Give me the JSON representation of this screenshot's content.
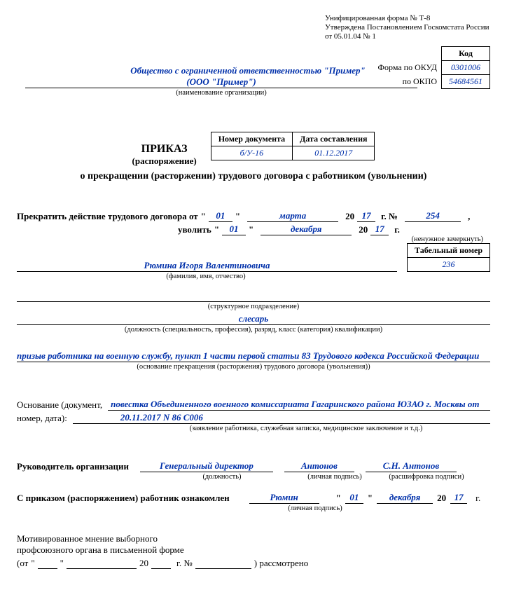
{
  "header": {
    "form_line": "Унифицированная форма № Т-8",
    "approved_line": "Утверждена Постановлением Госкомстата России",
    "date_line": "от 05.01.04 № 1",
    "code_header": "Код",
    "okud_label": "Форма по ОКУД",
    "okud_value": "0301006",
    "okpo_label": "по ОКПО",
    "okpo_value": "54684561"
  },
  "org": {
    "name_line1": "Общество с ограниченной ответственностью \"Пример\"",
    "name_line2": "(ООО \"Пример\")",
    "hint": "(наименование организации)"
  },
  "doc": {
    "num_header": "Номер документа",
    "date_header": "Дата составления",
    "num_value": "б/У-16",
    "date_value": "01.12.2017"
  },
  "title": {
    "main": "ПРИКАЗ",
    "sub": "(распоряжение)",
    "line": "о прекращении (расторжении) трудового договора с работником (увольнении)"
  },
  "terminate": {
    "prefix": "Прекратить действие трудового договора от",
    "day1": "01",
    "month1": "марта",
    "yy1": "17",
    "num_label": "г.  №",
    "num": "254",
    "dismiss_prefix": "уволить",
    "day2": "01",
    "month2": "декабря",
    "yy2": "17",
    "year_suffix": "г.",
    "hint": "(ненужное зачеркнуть)",
    "q_open": "\"",
    "q_close": "\"",
    "twenty": "20",
    "comma": ","
  },
  "employee": {
    "fio": "Рюмина Игоря Валентиновича",
    "fio_hint": "(фамилия, имя, отчество)",
    "tn_header": "Табельный номер",
    "tn_value": "236",
    "dept_hint": "(структурное подразделение)",
    "position": "слесарь",
    "position_hint": "(должность (специальность, профессия), разряд, класс (категория) квалификации)"
  },
  "reason": {
    "text": "призыв работника на военную службу, пункт 1 части первой статьи 83 Трудового кодекса Российской Федерации",
    "hint": "(основание прекращения (расторжения) трудового договора (увольнения))"
  },
  "basis": {
    "label1": "Основание (документ,",
    "label2": "номер, дата):",
    "text": "повестка Объединенного военного комиссариата Гагаринского района ЮЗАО г. Москвы от 20.11.2017 N 86 С006",
    "text_line1": "повестка Объединенного военного комиссариата Гагаринского района ЮЗАО г. Москвы от",
    "text_line2": "20.11.2017 N 86 С006",
    "hint": "(заявление работника, служебная записка, медицинское заключение и т.д.)"
  },
  "head": {
    "label": "Руководитель организации",
    "position": "Генеральный директор",
    "position_hint": "(должность)",
    "sign": "Антонов",
    "sign_hint": "(личная подпись)",
    "decode": "С.Н. Антонов",
    "decode_hint": "(расшифровка подписи)"
  },
  "ack": {
    "label": "С приказом (распоряжением) работник ознакомлен",
    "sign": "Рюмин",
    "sign_hint": "(личная подпись)",
    "day": "01",
    "month": "декабря",
    "yy": "17",
    "q_open": "\"",
    "q_close": "\"",
    "twenty": "20",
    "g": "г."
  },
  "union": {
    "line1": "Мотивированное мнение выборного",
    "line2": "профсоюзного органа в письменной форме",
    "from": "(от",
    "q_open": "\"",
    "q_close": "\"",
    "twenty": "20",
    "g_num": "г. №",
    "considered": ") рассмотрено"
  }
}
